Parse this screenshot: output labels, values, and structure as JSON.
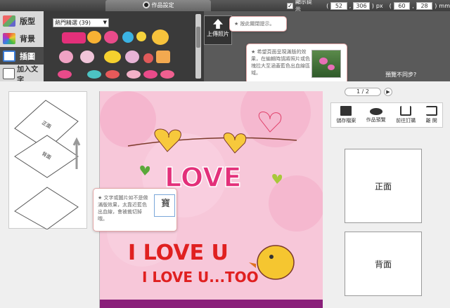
{
  "toolbar": {
    "work_settings_label": "作品設定",
    "show_hint_label": "顯示提示",
    "pos_x": "52",
    "pos_y": "306",
    "px_label": "px",
    "width": "60",
    "height": "28",
    "mm_label": "mm",
    "paren_open": "(",
    "comma": ",",
    "paren_close": ")"
  },
  "left_tabs": [
    {
      "label": "版型"
    },
    {
      "label": "背景"
    },
    {
      "label": "插圖"
    },
    {
      "label": "加入文字"
    }
  ],
  "stickers": {
    "category": "熱門精選 (39)"
  },
  "upload": {
    "label": "上傳照片"
  },
  "tips": {
    "close_tip": "★ 按此關閉提示。",
    "photo_tip": "★ 希望頁面呈現滿版的效果，在編輯時請將照片或色塊拉大至涵蓋藍色出血線區域。",
    "text_tip": "★ 文字或圖片如不是做滿版效果，太靠近藍色出血線，會被裁切掉哦。",
    "text_tip_sample": "寶"
  },
  "preview_link": "預覽不同步?",
  "pagination": {
    "label": "1 / 2"
  },
  "actions": [
    {
      "label": "儲存檔案"
    },
    {
      "label": "作品預覽"
    },
    {
      "label": "前往訂購"
    },
    {
      "label": "離 開"
    }
  ],
  "faces": {
    "front": "正面",
    "back": "背面"
  },
  "fold_labels": {
    "front": "正面",
    "back": "背面"
  },
  "colors": {
    "topbar": "#3d3d3d",
    "panel": "#3a3a3a",
    "canvas_bg": "#f7c7d9",
    "love_pink": "#e3307a",
    "accent_red": "#e02020"
  }
}
